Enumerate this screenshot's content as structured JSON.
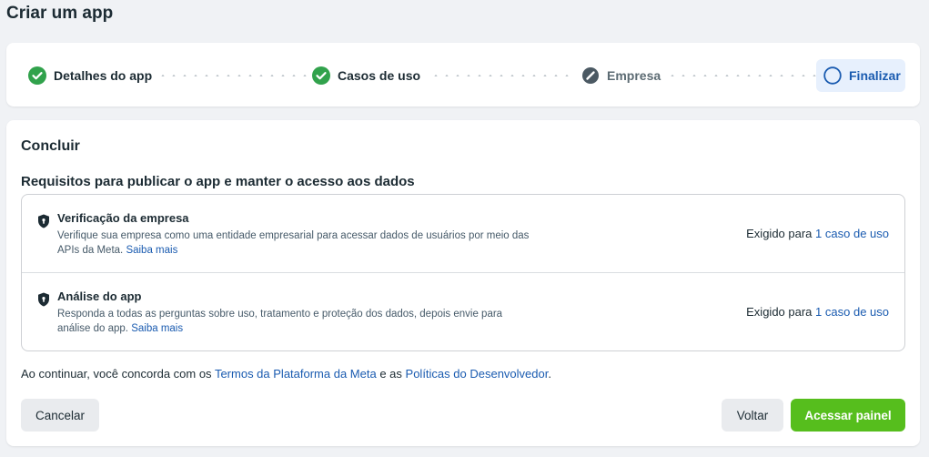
{
  "page": {
    "title": "Criar um app"
  },
  "stepper": {
    "steps": [
      {
        "label": "Detalhes do app",
        "state": "done"
      },
      {
        "label": "Casos de uso",
        "state": "done"
      },
      {
        "label": "Empresa",
        "state": "skipped"
      },
      {
        "label": "Finalizar",
        "state": "current"
      }
    ]
  },
  "main": {
    "section_title": "Concluir",
    "requirements_title": "Requisitos para publicar o app e manter o acesso aos dados",
    "requirements": [
      {
        "title": "Verificação da empresa",
        "description": "Verifique sua empresa como uma entidade empresarial para acessar dados de usuários por meio das APIs da Meta.",
        "link": "Saiba mais",
        "required_prefix": "Exigido para",
        "required_link": "1 caso de uso"
      },
      {
        "title": "Análise do app",
        "description": "Responda a todas as perguntas sobre uso, tratamento e proteção dos dados, depois envie para análise do app.",
        "link": "Saiba mais",
        "required_prefix": "Exigido para",
        "required_link": "1 caso de uso"
      }
    ],
    "terms": {
      "prefix": "Ao continuar, você concorda com os",
      "link1": "Termos da Plataforma da Meta",
      "middle": "e as",
      "link2": "Políticas do Desenvolvedor",
      "suffix": "."
    }
  },
  "buttons": {
    "cancel": "Cancelar",
    "back": "Voltar",
    "primary": "Acessar painel"
  },
  "colors": {
    "accent_green": "#56be1d",
    "check_green": "#31a24c",
    "link_blue": "#1a5bb0",
    "current_step_bg": "#e7f0fd"
  },
  "icons": {
    "done": "check-circle-icon",
    "skipped": "slash-circle-icon",
    "current": "empty-circle-icon",
    "requirement": "shield-icon"
  }
}
